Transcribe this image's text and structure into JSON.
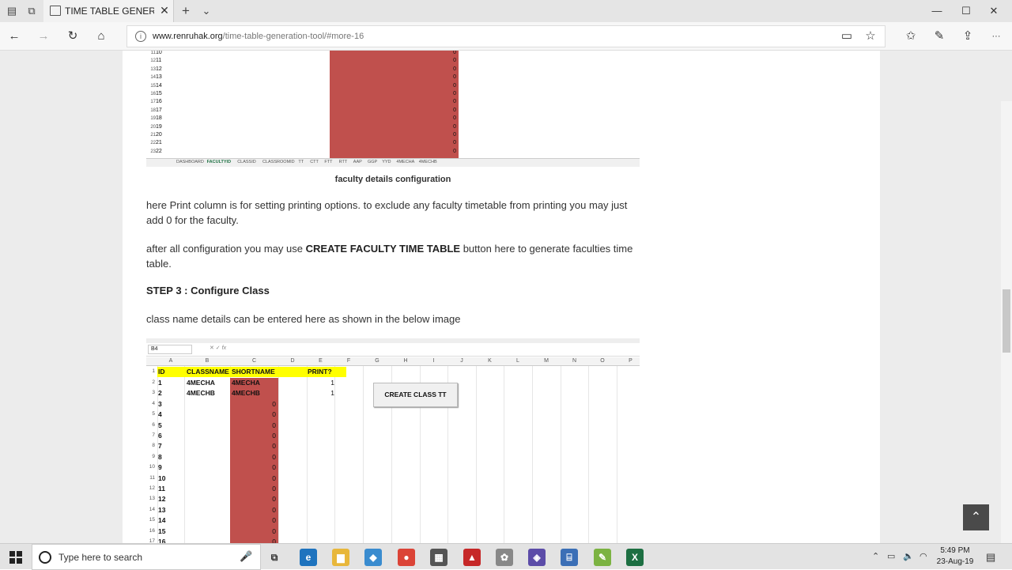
{
  "browser": {
    "tab_title": "TIME TABLE GENERATIC",
    "url_domain": "www.renruhak.org",
    "url_path": "/time-table-generation-tool/#more-16",
    "close_glyph": "✕",
    "new_tab_glyph": "+",
    "tab_menu_glyph": "⌄",
    "back_glyph": "←",
    "forward_glyph": "→",
    "refresh_glyph": "↻",
    "home_glyph": "⌂",
    "info_glyph": "i",
    "reading_glyph": "▭",
    "star_glyph": "☆",
    "favorites_glyph": "✩",
    "pen_glyph": "✎",
    "share_glyph": "⇪",
    "more_glyph": "···",
    "min_glyph": "—",
    "max_glyph": "☐",
    "winclose_glyph": "✕"
  },
  "article": {
    "sheet1_rows": [
      {
        "num": "11",
        "val": "10"
      },
      {
        "num": "12",
        "val": "11"
      },
      {
        "num": "13",
        "val": "12"
      },
      {
        "num": "14",
        "val": "13"
      },
      {
        "num": "15",
        "val": "14"
      },
      {
        "num": "16",
        "val": "15"
      },
      {
        "num": "17",
        "val": "16"
      },
      {
        "num": "18",
        "val": "17"
      },
      {
        "num": "19",
        "val": "18"
      },
      {
        "num": "20",
        "val": "19"
      },
      {
        "num": "21",
        "val": "20"
      },
      {
        "num": "22",
        "val": "21"
      },
      {
        "num": "23",
        "val": "22"
      }
    ],
    "zero": "0",
    "sheet_tabs": [
      "DASHBOARD",
      "FACULTYID",
      "CLASSID",
      "CLASSROOMID",
      "TT",
      "CTT",
      "FTT",
      "RTT",
      "AAP",
      "GGP",
      "YYD",
      "4MECHA",
      "4MECHB"
    ],
    "caption": "faculty details configuration",
    "para1": "here Print column is for setting printing options. to exclude any faculty timetable from printing you may just add 0 for the faculty.",
    "para2_pre": "after all configuration you may use ",
    "para2_bold": "CREATE FACULTY TIME TABLE",
    "para2_post": " button here to generate faculties time table.",
    "step3": "STEP 3 : Configure Class",
    "para3": "class name details can be entered here as shown in the below image"
  },
  "sheet2": {
    "namebox": "B4",
    "fx": "fx",
    "columns": [
      "A",
      "B",
      "C",
      "D",
      "E",
      "F",
      "G",
      "H",
      "I",
      "J",
      "K",
      "L",
      "M",
      "N",
      "O",
      "P"
    ],
    "headers": {
      "id": "ID",
      "classname": "CLASSNAME",
      "shortname": "SHORTNAME",
      "print": "PRINT?"
    },
    "rows": [
      {
        "num": "2",
        "id": "1",
        "classname": "4MECHA",
        "shortname": "4MECHA",
        "print": "1"
      },
      {
        "num": "3",
        "id": "2",
        "classname": "4MECHB",
        "shortname": "4MECHB",
        "print": "1"
      },
      {
        "num": "4",
        "id": "3",
        "zero": "0"
      },
      {
        "num": "5",
        "id": "4",
        "zero": "0"
      },
      {
        "num": "6",
        "id": "5",
        "zero": "0"
      },
      {
        "num": "7",
        "id": "6",
        "zero": "0"
      },
      {
        "num": "8",
        "id": "7",
        "zero": "0"
      },
      {
        "num": "9",
        "id": "8",
        "zero": "0"
      },
      {
        "num": "10",
        "id": "9",
        "zero": "0"
      },
      {
        "num": "11",
        "id": "10",
        "zero": "0"
      },
      {
        "num": "12",
        "id": "11",
        "zero": "0"
      },
      {
        "num": "13",
        "id": "12",
        "zero": "0"
      },
      {
        "num": "14",
        "id": "13",
        "zero": "0"
      },
      {
        "num": "15",
        "id": "14",
        "zero": "0"
      },
      {
        "num": "16",
        "id": "15",
        "zero": "0"
      },
      {
        "num": "17",
        "id": "16",
        "zero": "0"
      }
    ],
    "button": "CREATE CLASS TT",
    "header_row_num": "1"
  },
  "scroll_up_glyph": "⌃",
  "taskbar": {
    "search_placeholder": "Type here to search",
    "mic_glyph": "🎤",
    "time": "5:49 PM",
    "date": "23-Aug-19",
    "icons": [
      {
        "name": "task-view-icon",
        "glyph": "⧉",
        "color": "#e3e3e3"
      },
      {
        "name": "edge-icon",
        "glyph": "e",
        "color": "#1e73be"
      },
      {
        "name": "file-explorer-icon",
        "glyph": "▆",
        "color": "#e8b73b"
      },
      {
        "name": "app-icon-blue",
        "glyph": "◆",
        "color": "#3a8ccf"
      },
      {
        "name": "chrome-icon",
        "glyph": "●",
        "color": "#db4437"
      },
      {
        "name": "calculator-icon",
        "glyph": "▦",
        "color": "#555555"
      },
      {
        "name": "app-icon-red",
        "glyph": "▲",
        "color": "#c62828"
      },
      {
        "name": "paint-icon",
        "glyph": "✿",
        "color": "#888888"
      },
      {
        "name": "app-icon-purple",
        "glyph": "◈",
        "color": "#5c4ca8"
      },
      {
        "name": "network-app-icon",
        "glyph": "⌸",
        "color": "#3b6fb6"
      },
      {
        "name": "notepad-icon",
        "glyph": "✎",
        "color": "#7cb342"
      },
      {
        "name": "excel-icon",
        "glyph": "X",
        "color": "#1d6f42"
      }
    ],
    "tray_up_glyph": "⌃",
    "battery_glyph": "▭",
    "volume_glyph": "🔈",
    "wifi_glyph": "◠",
    "notification_glyph": "▤"
  }
}
